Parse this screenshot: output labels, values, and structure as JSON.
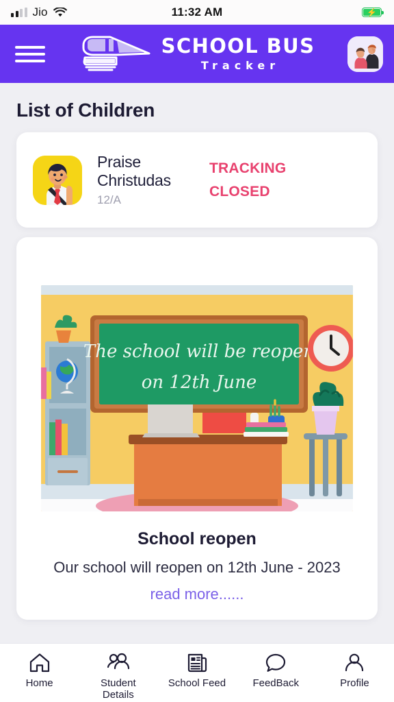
{
  "status_bar": {
    "carrier": "Jio",
    "time": "11:32 AM",
    "signal_bars_filled": 2,
    "signal_bars_total": 4,
    "wifi_icon": "wifi-icon",
    "battery_icon": "battery-charging-icon",
    "battery_charging": true
  },
  "header": {
    "menu_icon": "hamburger-menu-icon",
    "logo_icon": "school-bus-logo-icon",
    "brand_title": "SCHOOL BUS",
    "brand_subtitle": "Tracker",
    "avatar_icon": "parents-avatar-icon",
    "background_color": "#6634F0"
  },
  "page": {
    "title": "List of Children",
    "background_color": "#EFEFF3"
  },
  "children": [
    {
      "avatar_icon": "student-avatar-icon",
      "name": "Praise Christudas",
      "class": "12/A",
      "status_line_1": "TRACKING",
      "status_line_2": "CLOSED",
      "status_color": "#E8416E"
    }
  ],
  "feed": {
    "illustration": {
      "icon": "classroom-illustration",
      "chalkboard_line_1": "The school will be reopen",
      "chalkboard_line_2": "on 12th June",
      "clock_icon": "wall-clock-icon",
      "globe_icon": "globe-icon",
      "laptop_icon": "laptop-icon",
      "plant_icon": "potted-plant-icon",
      "books_icon": "books-icon",
      "pencil_cup_icon": "pencil-cup-icon"
    },
    "title": "School reopen",
    "text": "Our school will reopen on 12th June - 2023 ",
    "read_more": "read more......",
    "read_more_color": "#7B61E8"
  },
  "tabbar": {
    "items": [
      {
        "icon": "home-icon",
        "label": "Home"
      },
      {
        "icon": "students-icon",
        "label": "Student\nDetails",
        "label_line_1": "Student",
        "label_line_2": "Details"
      },
      {
        "icon": "newspaper-icon",
        "label": "School Feed"
      },
      {
        "icon": "chat-bubble-icon",
        "label": "FeedBack"
      },
      {
        "icon": "person-icon",
        "label": "Profile"
      }
    ]
  }
}
